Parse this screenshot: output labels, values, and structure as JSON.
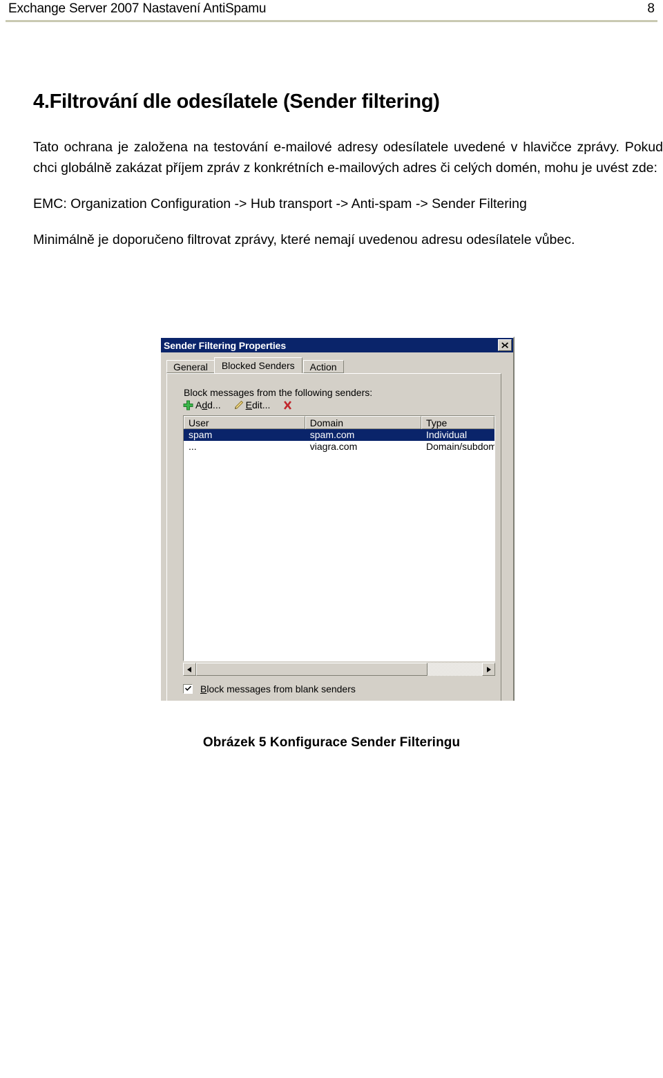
{
  "page": {
    "header_title": "Exchange Server 2007 Nastavení AntiSpamu",
    "page_number": "8",
    "rule_color": "#c9c9b2"
  },
  "document": {
    "section_title": "4.Filtrování dle odesílatele (Sender filtering)",
    "paragraph_1": "Tato ochrana je založena na testování e-mailové adresy odesílatele uvedené v hlavičce zprávy. Pokud chci globálně zakázat příjem zpráv z konkrétních e-mailových adres či celých domén, mohu je uvést zde:",
    "path_line": "EMC: Organization Configuration -> Hub transport -> Anti-spam ->  Sender Filtering",
    "paragraph_2": "Minimálně je doporučeno filtrovat zprávy, které nemají uvedenou adresu odesílatele vůbec.",
    "figure_caption": "Obrázek 5 Konfigurace Sender Filteringu"
  },
  "dialog": {
    "title": "Sender Filtering Properties",
    "close_label": "x",
    "titlebar_color": "#0a246a",
    "face_color": "#d4d0c8",
    "selection_color": "#0a246a",
    "tabs": [
      {
        "label": "General",
        "active": false
      },
      {
        "label": "Blocked Senders",
        "active": true
      },
      {
        "label": "Action",
        "active": false
      }
    ],
    "field_label": "Block messages from the following senders:",
    "toolbar": [
      {
        "label": "Add...",
        "icon": "plus-icon",
        "icon_color": "#39b54a"
      },
      {
        "label": "Edit...",
        "icon": "pencil-icon",
        "icon_color": "#d8a100"
      },
      {
        "label": "",
        "icon": "delete-x-icon",
        "icon_color": "#c1272d"
      }
    ],
    "listview": {
      "columns": [
        "User",
        "Domain",
        "Type"
      ],
      "rows": [
        {
          "user": "spam",
          "domain": "spam.com",
          "type": "Individual",
          "selected": true
        },
        {
          "user": "...",
          "domain": "viagra.com",
          "type": "Domain/subdom",
          "selected": false
        }
      ]
    },
    "scrollbar": {
      "left_arrow": "◀",
      "right_arrow": "▶",
      "thumb_percent": "81"
    },
    "checkbox": {
      "label_prefix": "B",
      "label_rest": "lock messages from blank senders",
      "checked": true
    }
  }
}
